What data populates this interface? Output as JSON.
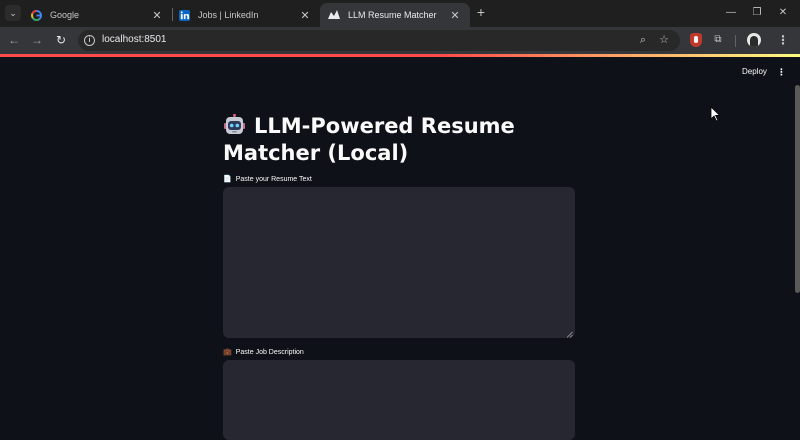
{
  "browser": {
    "tabs": [
      {
        "title": "Google",
        "icon": "google-icon",
        "active": false
      },
      {
        "title": "Jobs | LinkedIn",
        "icon": "linkedin-icon",
        "active": false
      },
      {
        "title": "LLM Resume Matcher",
        "icon": "streamlit-icon",
        "active": true
      }
    ],
    "url": "localhost:8501",
    "controls": {
      "tab_search": "⌄",
      "new_tab": "+",
      "minimize": "—",
      "restore": "❐",
      "close": "✕",
      "tab_close": "✕",
      "back": "←",
      "forward": "→",
      "reload": "↻",
      "info": "i",
      "zoom": "⌕",
      "bookmark": "☆",
      "extensions": "⧉",
      "menu": "⋮"
    }
  },
  "app": {
    "deploy_label": "Deploy",
    "menu_label": "⋮",
    "title_emoji_icon": "robot-icon",
    "title": "LLM-Powered Resume Matcher (Local)",
    "resume_field": {
      "icon": "📄",
      "label": "Paste your Resume Text",
      "value": ""
    },
    "job_field": {
      "icon": "💼",
      "label": "Paste Job Description",
      "value": ""
    }
  },
  "colors": {
    "app_background": "#0e1117",
    "input_background": "#262730",
    "accent_start": "#ff4b4b",
    "accent_end": "#fffd80",
    "chrome_tabstrip": "#1f1f1f",
    "chrome_toolbar": "#35363a"
  }
}
